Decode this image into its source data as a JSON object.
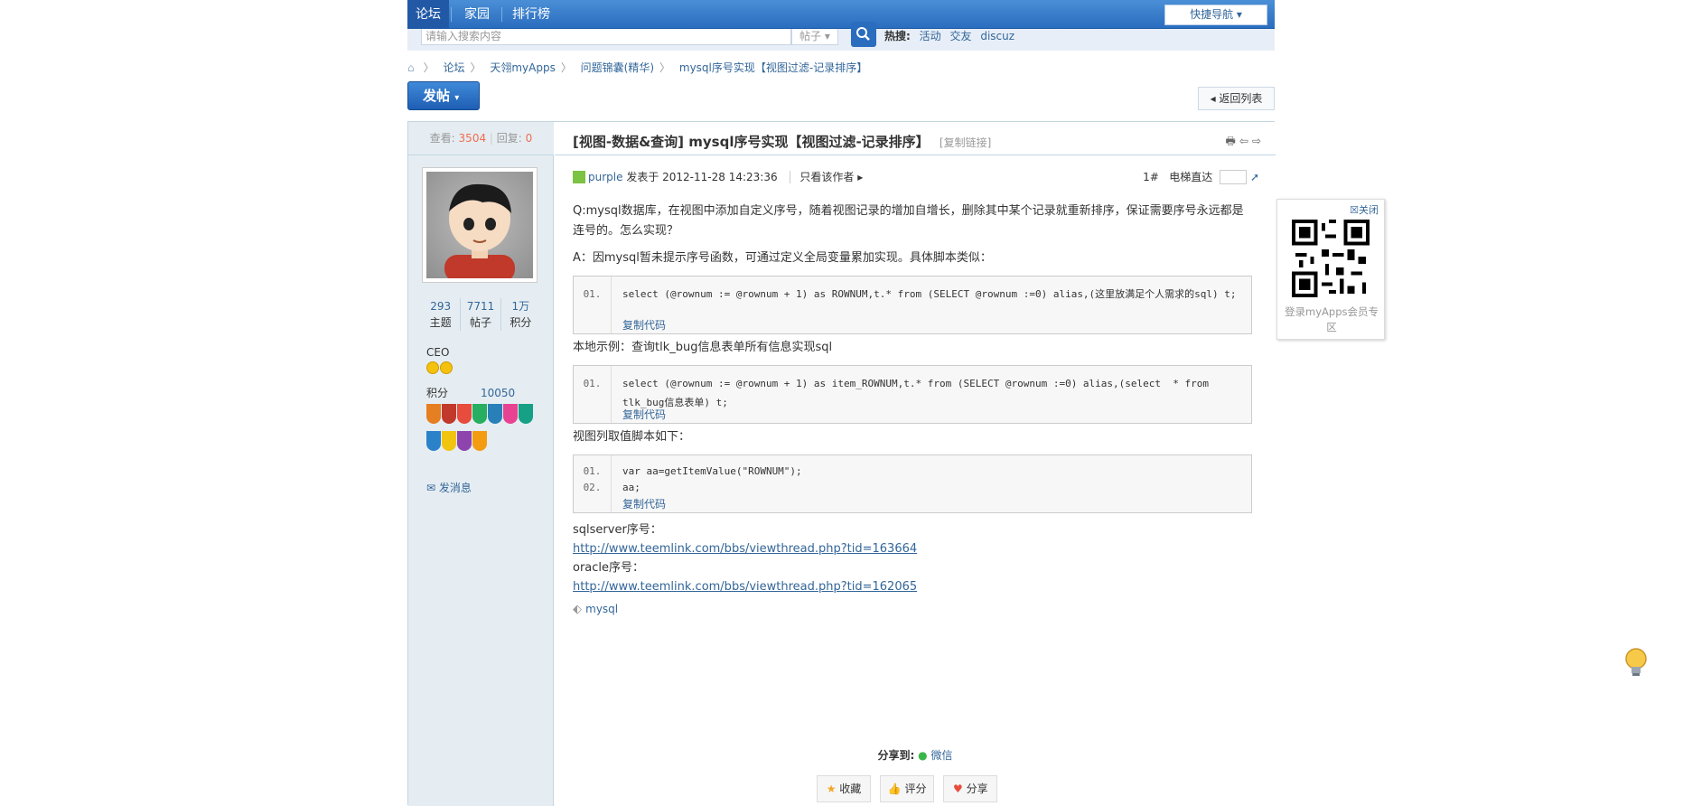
{
  "nav": {
    "tabs": [
      "论坛",
      "家园",
      "排行榜"
    ],
    "quick_nav": "快捷导航"
  },
  "search": {
    "placeholder": "请输入搜索内容",
    "type": "帖子",
    "hot_label": "热搜:",
    "hot_words": [
      "活动",
      "交友",
      "discuz"
    ]
  },
  "breadcrumb": [
    "论坛",
    "天翎myApps",
    "问题锦囊(精华)",
    "mysql序号实现【视图过滤-记录排序】"
  ],
  "post_button": "发帖",
  "back_button": "返回列表",
  "stats": {
    "views_label": "查看:",
    "views": "3504",
    "replies_label": "回复:",
    "replies": "0"
  },
  "user": {
    "counts": [
      {
        "value": "293",
        "label": "主题"
      },
      {
        "value": "7711",
        "label": "帖子"
      },
      {
        "value": "1万",
        "label": "积分"
      }
    ],
    "rank": "CEO",
    "credit_label": "积分",
    "credit_value": "10050",
    "send_message": "发消息"
  },
  "thread": {
    "title": "[视图-数据&查询] mysql序号实现【视图过滤-记录排序】",
    "copy_link": "[复制链接]",
    "author": "purple",
    "posted": "发表于 2012-11-28 14:23:36",
    "only_author": "只看该作者",
    "floor": "1#",
    "elevator": "电梯直达"
  },
  "content": {
    "q": "Q:mysql数据库，在视图中添加自定义序号，随着视图记录的增加自增长，删除其中某个记录就重新排序，保证需要序号永远都是连号的。怎么实现？",
    "a": "A：因mysql暂未提示序号函数，可通过定义全局变量累加实现。具体脚本类似：",
    "code1_nums": "01.",
    "code1": "select (@rownum := @rownum + 1) as ROWNUM,t.* from (SELECT @rownum :=0) alias,(这里放满足个人需求的sql) t;",
    "local_example": "本地示例：查询tlk_bug信息表单所有信息实现sql",
    "code2_nums": "01.",
    "code2": "select (@rownum := @rownum + 1) as item_ROWNUM,t.* from (SELECT @rownum :=0) alias,(select  * from tlk_bug信息表单) t;",
    "view_column": "视图列取值脚本如下：",
    "code3_nums": "01.\n02.",
    "code3": "var aa=getItemValue(\"ROWNUM\");\naa;",
    "copy_code": "复制代码",
    "sqlserver": "sqlserver序号：",
    "sqlserver_url": "http://www.teemlink.com/bbs/viewthread.php?tid=163664",
    "oracle": "oracle序号：",
    "oracle_url": "http://www.teemlink.com/bbs/viewthread.php?tid=162065",
    "tag": "mysql"
  },
  "share": {
    "label": "分享到:",
    "wechat": "微信"
  },
  "actions": [
    "收藏",
    "评分",
    "分享"
  ],
  "qr": {
    "close": "关闭",
    "caption": "登录myApps会员专区"
  },
  "colors": {
    "nav_blue": "#2a6dbf",
    "link": "#336699",
    "count_red": "#f26c4f"
  }
}
